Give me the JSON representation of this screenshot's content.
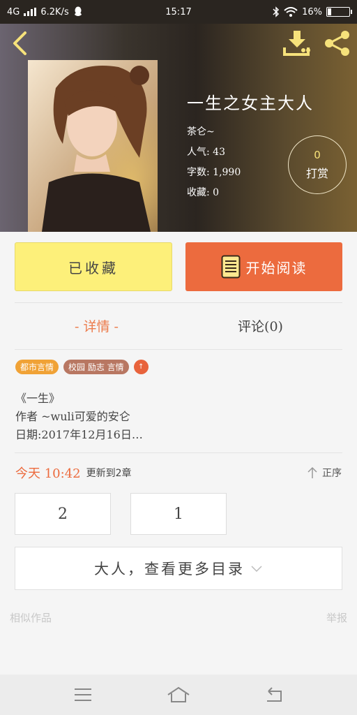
{
  "status_bar": {
    "network": "4G",
    "speed": "6.2K/s",
    "time": "15:17",
    "battery": "16%",
    "battery_level": 0.16
  },
  "book": {
    "title": "一生之女主大人",
    "author": "茶仑~",
    "popularity": "人气: 43",
    "word_count": "字数: 1,990",
    "collections": "收藏: 0",
    "reward_count": "0",
    "reward_label": "打赏"
  },
  "actions": {
    "collect_label": "已收藏",
    "read_label": "开始阅读"
  },
  "tabs": {
    "detail": "- 详情 -",
    "comments": "评论(0)"
  },
  "tags": [
    "都市言情",
    "校园 励志 言情"
  ],
  "tag_more": "↑",
  "description": {
    "line1": "《一生》",
    "line2": "作者 ~wuli可爱的安仑",
    "line3": "日期:2017年12月16日…"
  },
  "update": {
    "time": "今天 10:42",
    "text": "更新到2章",
    "sort_label": "正序"
  },
  "chapters": [
    "2",
    "1"
  ],
  "more_catalog_label": "大人，查看更多目录",
  "footer": {
    "similar": "相似作品",
    "report": "举报"
  },
  "colors": {
    "accent_orange": "#ec6b3e",
    "collect_yellow": "#fdf07a",
    "icon_yellow": "#f6e27b"
  },
  "icons": {
    "back": "back-arrow-icon",
    "download": "download-icon",
    "share": "share-icon",
    "book": "book-icon",
    "chevron": "chevron-down-icon",
    "sort": "arrow-up-icon"
  }
}
